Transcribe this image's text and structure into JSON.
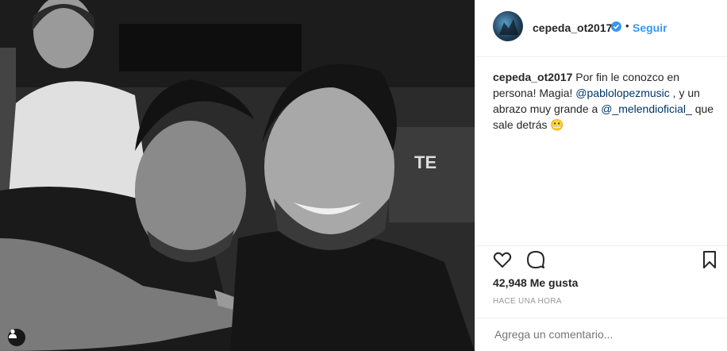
{
  "header": {
    "username": "cepeda_ot2017",
    "separator": "•",
    "follow_label": "Seguir"
  },
  "caption": {
    "username": "cepeda_ot2017",
    "text_1": "Por fin le conozco en persona! Magia! ",
    "mention_1": "@pablolopezmusic",
    "text_2": " , y un abrazo muy grande a ",
    "mention_2": "@_melendioficial_",
    "text_3": " que sale detrás ",
    "emoji": "😬"
  },
  "stats": {
    "likes": "42,948 Me gusta",
    "time": "HACE UNA HORA"
  },
  "comment": {
    "placeholder": "Agrega un comentario..."
  },
  "colors": {
    "accent": "#3897f0",
    "mention": "#003569",
    "muted": "#999999"
  },
  "icons": {
    "like": "heart-icon",
    "comment": "comment-icon",
    "save": "bookmark-icon",
    "tag": "user-tag-icon",
    "verified": "verified-badge-icon"
  }
}
